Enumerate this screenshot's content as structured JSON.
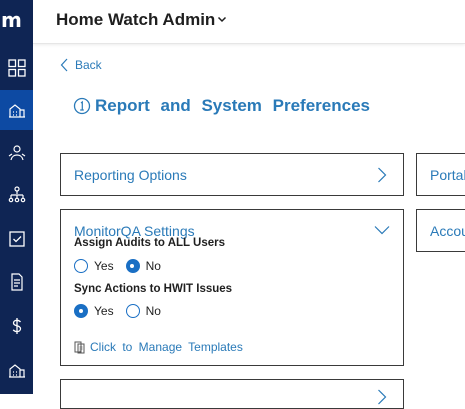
{
  "brand": {
    "logo_text": "m"
  },
  "header": {
    "app_title": "Home Watch Admin"
  },
  "back": {
    "label": "Back"
  },
  "page": {
    "title": "Report and System Preferences"
  },
  "cards": {
    "reporting": {
      "label": "Reporting Options"
    },
    "portal": {
      "label": "Portal"
    },
    "monitorqa": {
      "label": "MonitorQA Settings",
      "assign_audits": {
        "label": "Assign Audits to ALL Users",
        "options": [
          "Yes",
          "No"
        ],
        "selected": "No"
      },
      "sync_actions": {
        "label": "Sync Actions to HWIT Issues",
        "options": [
          "Yes",
          "No"
        ],
        "selected": "Yes"
      },
      "manage_templates_link": "Click to Manage Templates"
    },
    "account": {
      "label": "Accou"
    }
  },
  "colors": {
    "sidebar": "#0f2554",
    "sidebar_active": "#0d4aa3",
    "accent": "#2a7ab8",
    "radio": "#1a6fc4"
  },
  "sidebar_icons": [
    "dashboard-icon",
    "home-building-icon",
    "people-icon",
    "network-icon",
    "checkbox-icon",
    "document-icon",
    "dollar-icon",
    "building-icon"
  ]
}
